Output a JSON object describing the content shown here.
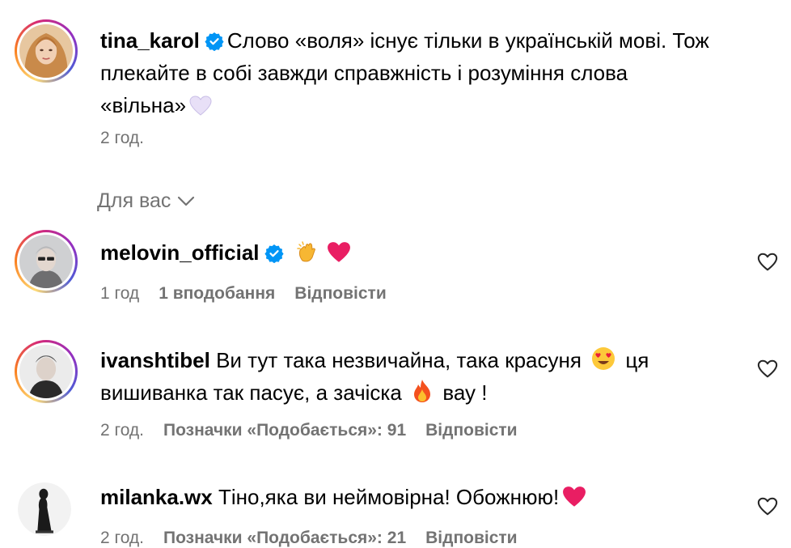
{
  "caption": {
    "username": "tina_karol",
    "text": "Слово «воля» існує тільки в українській мові. Тож плекайте в собі завжди справжність і розуміння слова «вільна»",
    "emoji": "white-heart-icon",
    "time": "2 год."
  },
  "section": {
    "label": "Для вас"
  },
  "comments": [
    {
      "username": "melovin_official",
      "text": "",
      "emojis": [
        "clapping-hands-icon",
        "red-heart-icon"
      ],
      "time": "1 год",
      "likes": "1 вподобання",
      "reply": "Відповісти"
    },
    {
      "username": "ivanshtibel",
      "text_part1": "Ви тут така незвичайна, така красуня",
      "text_part2": "ця вишиванка так пасує, а зачіска",
      "text_part3": "вау !",
      "emojis": [
        "heart-eyes-face-icon",
        "fire-icon"
      ],
      "time": "2 год.",
      "likes": "Позначки «Подобається»: 91",
      "reply": "Відповісти"
    },
    {
      "username": "milanka.wx",
      "text": "Тіно,яка ви неймовірна! Обожнюю!",
      "emojis": [
        "red-heart-icon"
      ],
      "time": "2 год.",
      "likes": "Позначки «Подобається»: 21",
      "reply": "Відповісти"
    }
  ],
  "colors": {
    "verified": "#0095f6",
    "meta": "#737373",
    "heart": "#e91e63"
  }
}
